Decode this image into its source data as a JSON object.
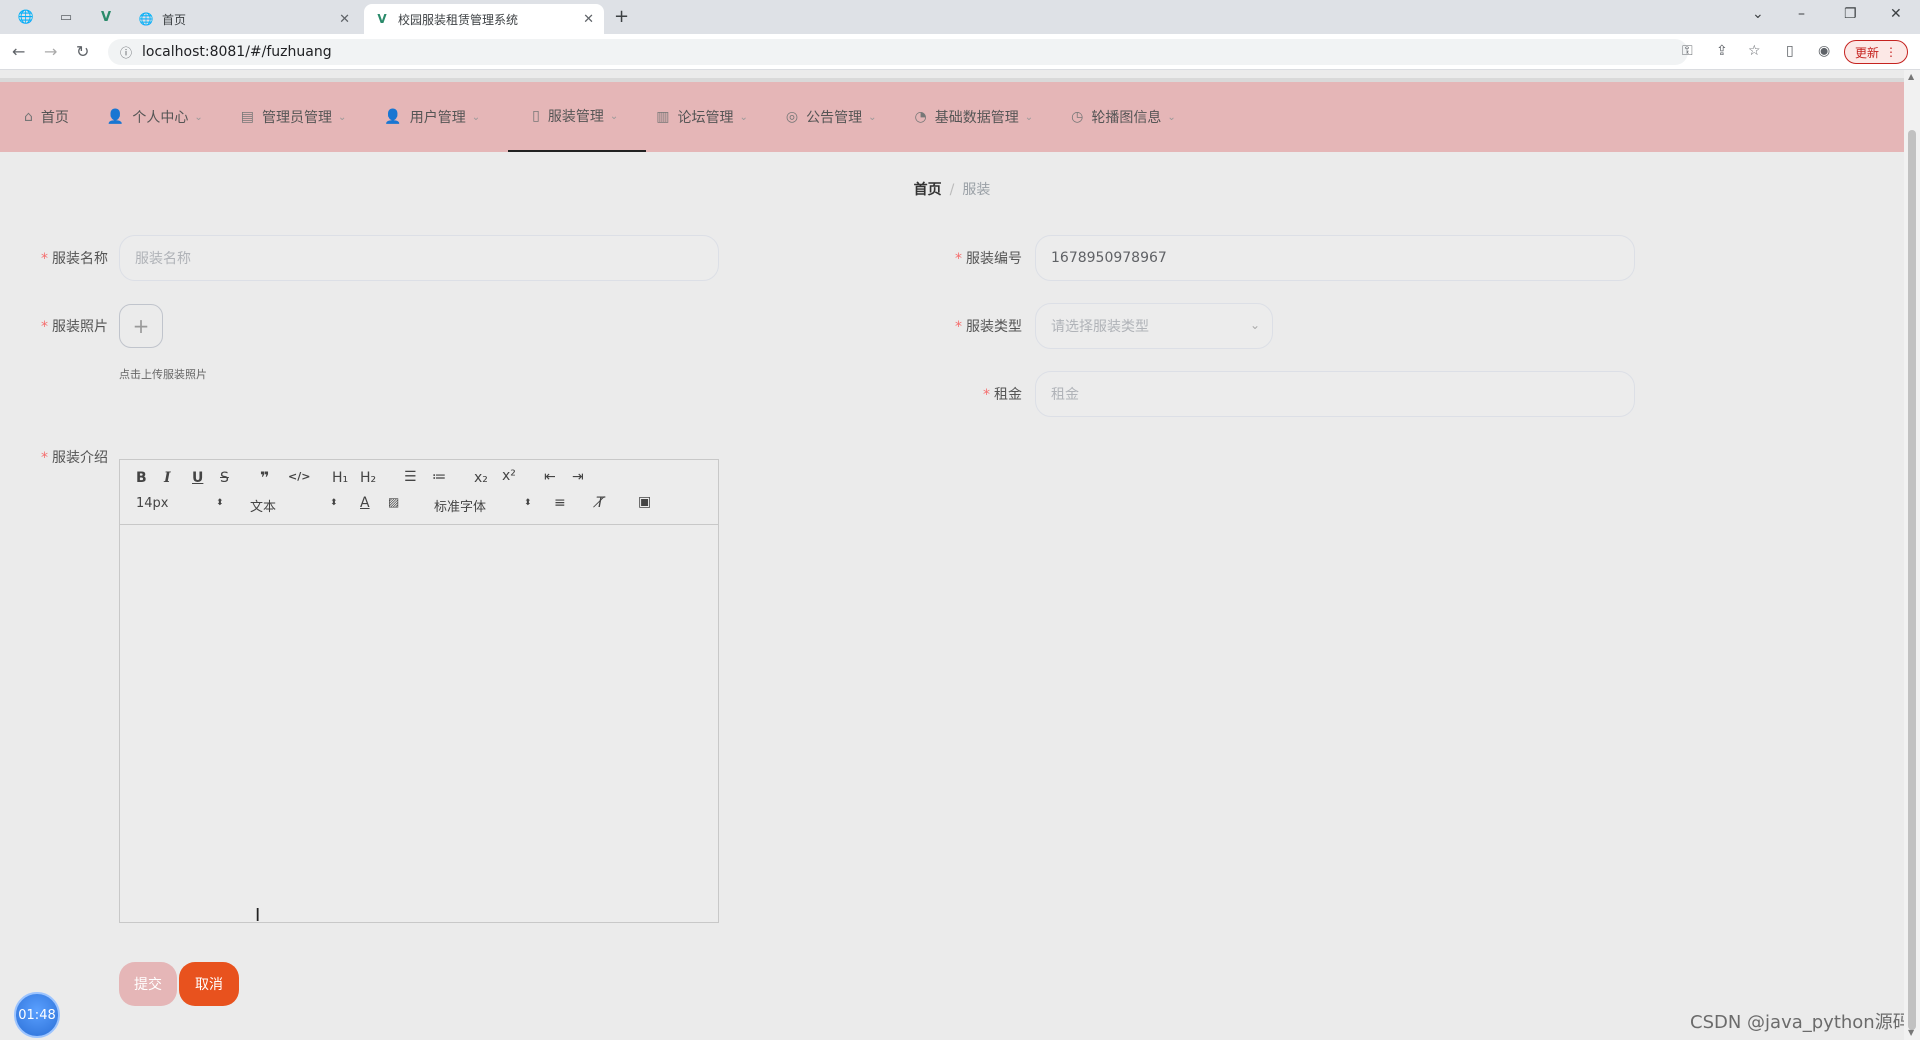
{
  "browser": {
    "tabs": [
      {
        "label": "首页",
        "active": false
      },
      {
        "label": "校园服装租赁管理系统",
        "active": true
      }
    ],
    "new_tab": "+",
    "url": "localhost:8081/#/fuzhuang",
    "update_label": "更新",
    "window_controls": {
      "tablist": "⌄",
      "minimize": "–",
      "restore": "❐",
      "close": "✕"
    }
  },
  "nav": {
    "items": [
      {
        "label": "首页",
        "icon": "home-icon",
        "has_dropdown": false,
        "active": false
      },
      {
        "label": "个人中心",
        "icon": "user-icon",
        "has_dropdown": true,
        "active": false
      },
      {
        "label": "管理员管理",
        "icon": "chart-icon",
        "has_dropdown": true,
        "active": false
      },
      {
        "label": "用户管理",
        "icon": "user-icon",
        "has_dropdown": true,
        "active": false
      },
      {
        "label": "服装管理",
        "icon": "phone-icon",
        "has_dropdown": true,
        "active": true
      },
      {
        "label": "论坛管理",
        "icon": "book-icon",
        "has_dropdown": true,
        "active": false
      },
      {
        "label": "公告管理",
        "icon": "globe-icon",
        "has_dropdown": true,
        "active": false
      },
      {
        "label": "基础数据管理",
        "icon": "compass-icon",
        "has_dropdown": true,
        "active": false
      },
      {
        "label": "轮播图信息",
        "icon": "gauge-icon",
        "has_dropdown": true,
        "active": false
      }
    ]
  },
  "breadcrumb": {
    "home": "首页",
    "separator": "/",
    "current": "服装"
  },
  "form": {
    "name": {
      "label": "服装名称",
      "placeholder": "服装名称",
      "value": ""
    },
    "code": {
      "label": "服装编号",
      "value": "1678950978967"
    },
    "photo": {
      "label": "服装照片",
      "hint": "点击上传服装照片"
    },
    "type": {
      "label": "服装类型",
      "placeholder": "请选择服装类型"
    },
    "rent": {
      "label": "租金",
      "placeholder": "租金",
      "value": ""
    },
    "intro": {
      "label": "服装介绍",
      "size": "14px",
      "style": "文本",
      "font": "标准字体"
    }
  },
  "buttons": {
    "submit": "提交",
    "cancel": "取消"
  },
  "timer": "01:48",
  "watermark": "CSDN @java_python源码"
}
